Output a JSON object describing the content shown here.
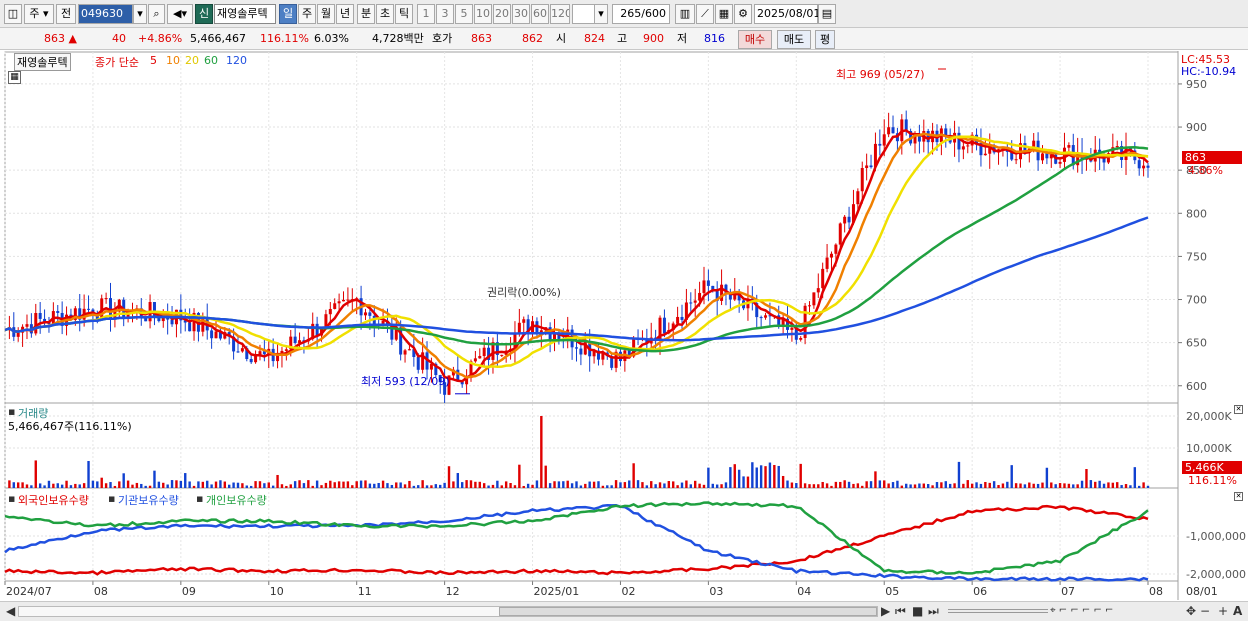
{
  "toolbar": {
    "market": "주",
    "period_mode": "전",
    "code": "049630",
    "badge": "신",
    "name": "재영솔루텍",
    "periods": [
      "일",
      "주",
      "월",
      "년",
      "분",
      "초",
      "틱"
    ],
    "active_period": "일",
    "intervals": [
      "1",
      "3",
      "5",
      "10",
      "20",
      "30",
      "60",
      "120"
    ],
    "count": "265",
    "count_max": "/600",
    "date": "2025/08/01"
  },
  "quote": {
    "price": "863",
    "change": "40",
    "change_pct": "+4.86%",
    "volume": "5,466,467",
    "vol_ratio": "116.11%",
    "turnover": "6.03%",
    "amount": "4,728백만",
    "quote_label": "호가",
    "ask": "863",
    "bid": "862",
    "open_label": "시",
    "open": "824",
    "high_label": "고",
    "high": "900",
    "low_label": "저",
    "low": "816",
    "buy_label": "매수",
    "sell_label": "매도",
    "avg_label": "평"
  },
  "price_panel": {
    "tab": "재영솔루텍",
    "ma_title": "종가 단순",
    "ma_periods": [
      "5",
      "10",
      "20",
      "60",
      "120"
    ],
    "ma_colors": [
      "#e00000",
      "#f08000",
      "#f0e000",
      "#20a040",
      "#2050e0"
    ],
    "lc": "LC:45.53",
    "hc": "HC:-10.94",
    "y_ticks": [
      "950",
      "900",
      "850",
      "800",
      "750",
      "700",
      "650",
      "600"
    ],
    "last_price": "863",
    "last_pct": "4.86%",
    "high_annot": "최고 969 (05/27)",
    "low_annot": "최저 593 (12/09)",
    "ex_annot": "권리락(0.00%)"
  },
  "volume_panel": {
    "title": "거래량",
    "value": "5,466,467주(116.11%)",
    "y_ticks": [
      "20,000K",
      "10,000K"
    ],
    "last": "5,466K",
    "last_pct": "116.11%"
  },
  "holdings_panel": {
    "series": [
      "외국인보유수량",
      "기관보유수량",
      "개인보유수량"
    ],
    "colors": [
      "#e00000",
      "#2050e0",
      "#20a040"
    ],
    "y_ticks": [
      "-1,000,000",
      "-2,000,000"
    ]
  },
  "x_axis": [
    "2024/07",
    "08",
    "09",
    "10",
    "11",
    "12",
    "2025/01",
    "02",
    "03",
    "04",
    "05",
    "06",
    "07",
    "08"
  ],
  "x_axis_right": "08/01",
  "chart_data": {
    "type": "line",
    "x": [
      "2024/07",
      "08",
      "09",
      "10",
      "11",
      "12",
      "2025/01",
      "02",
      "03",
      "04",
      "05",
      "06",
      "07",
      "08"
    ],
    "series": [
      {
        "name": "종가",
        "values": [
          665,
          690,
          680,
          630,
          700,
          600,
          675,
          630,
          715,
          655,
          900,
          880,
          870,
          863
        ]
      },
      {
        "name": "120",
        "values": [
          648,
          665,
          678,
          675,
          667,
          663,
          660,
          656,
          662,
          668,
          700,
          735,
          770,
          790
        ]
      }
    ],
    "ylim": [
      580,
      965
    ]
  }
}
